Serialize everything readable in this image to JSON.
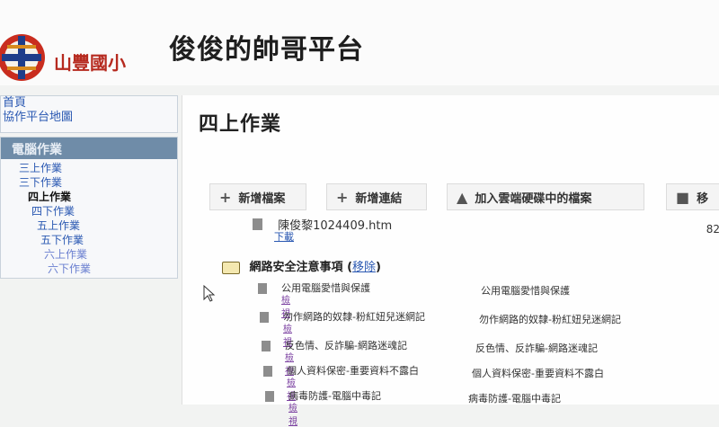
{
  "header": {
    "logo_text": "山豐國小",
    "site_title": "俊俊的帥哥平台"
  },
  "sidebar": {
    "top_links": [
      "首頁",
      "協作平台地圖"
    ],
    "section_title": "電腦作業",
    "items": [
      {
        "label": "三上作業"
      },
      {
        "label": "三下作業"
      },
      {
        "label": "四上作業",
        "active": true
      },
      {
        "label": "四下作業"
      },
      {
        "label": "五上作業"
      },
      {
        "label": "五下作業"
      },
      {
        "label": "六上作業"
      },
      {
        "label": "六下作業"
      }
    ]
  },
  "main": {
    "page_title": "四上作業",
    "toolbar": {
      "add_file": "新增檔案",
      "add_link": "新增連結",
      "add_drive": "加入雲端硬碟中的檔案",
      "move": "移"
    },
    "attachment": {
      "name": "陳俊黎1024409.htm",
      "download": "下載",
      "size": "82"
    },
    "folder": {
      "name": "網路安全注意事項",
      "remove": "移除"
    },
    "links": [
      {
        "name": "公用電腦愛惜與保護",
        "action": "檢視",
        "desc": "公用電腦愛惜與保護"
      },
      {
        "name": "勿作網路的奴隸-粉紅妞兒迷網記",
        "action": "檢視",
        "desc": "勿作網路的奴隸-粉紅妞兒迷網記"
      },
      {
        "name": "反色情、反詐騙-網路迷魂記",
        "action": "檢視",
        "desc": "反色情、反詐騙-網路迷魂記"
      },
      {
        "name": "個人資料保密-重要資料不露白",
        "action": "檢視",
        "desc": "個人資料保密-重要資料不露白"
      },
      {
        "name": "病毒防護-電腦中毒記",
        "action": "檢視",
        "desc": "病毒防護-電腦中毒記"
      }
    ]
  },
  "colors": {
    "accent_red": "#b62a1f",
    "link_blue": "#2a58b2",
    "sidebar_header": "#6f8ca8"
  }
}
